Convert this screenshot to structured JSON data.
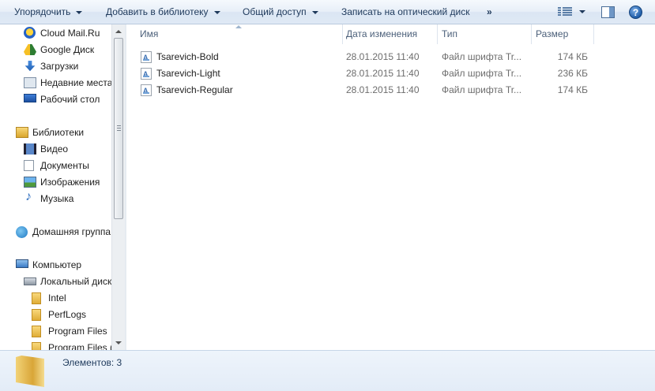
{
  "toolbar": {
    "organize_label": "Упорядочить",
    "add_to_library_label": "Добавить в библиотеку",
    "share_label": "Общий доступ",
    "burn_label": "Записать на оптический диск",
    "more_label": "»"
  },
  "navigation": {
    "items": [
      {
        "label": "Cloud Mail.Ru",
        "icon": "cloud-mail-icon"
      },
      {
        "label": "Google Диск",
        "icon": "google-drive-icon"
      },
      {
        "label": "Загрузки",
        "icon": "downloads-icon"
      },
      {
        "label": "Недавние места",
        "icon": "recent-places-icon"
      },
      {
        "label": "Рабочий стол",
        "icon": "desktop-icon"
      },
      {
        "label": "Библиотеки",
        "icon": "libraries-icon"
      },
      {
        "label": "Видео",
        "icon": "video-icon"
      },
      {
        "label": "Документы",
        "icon": "documents-icon"
      },
      {
        "label": "Изображения",
        "icon": "images-icon"
      },
      {
        "label": "Музыка",
        "icon": "music-icon"
      },
      {
        "label": "Домашняя группа",
        "icon": "homegroup-icon"
      },
      {
        "label": "Компьютер",
        "icon": "computer-icon"
      },
      {
        "label": "Локальный диск",
        "icon": "local-disk-icon"
      },
      {
        "label": "Intel",
        "icon": "folder-icon"
      },
      {
        "label": "PerfLogs",
        "icon": "folder-icon"
      },
      {
        "label": "Program Files",
        "icon": "folder-icon"
      },
      {
        "label": "Program Files (",
        "icon": "folder-icon"
      }
    ]
  },
  "columns": {
    "name": "Имя",
    "date": "Дата изменения",
    "type": "Тип",
    "size": "Размер"
  },
  "files": [
    {
      "name": "Tsarevich-Bold",
      "date": "28.01.2015 11:40",
      "type": "Файл шрифта Tr...",
      "size": "174 КБ"
    },
    {
      "name": "Tsarevich-Light",
      "date": "28.01.2015 11:40",
      "type": "Файл шрифта Tr...",
      "size": "236 КБ"
    },
    {
      "name": "Tsarevich-Regular",
      "date": "28.01.2015 11:40",
      "type": "Файл шрифта Tr...",
      "size": "174 КБ"
    }
  ],
  "status": {
    "text": "Элементов: 3"
  }
}
